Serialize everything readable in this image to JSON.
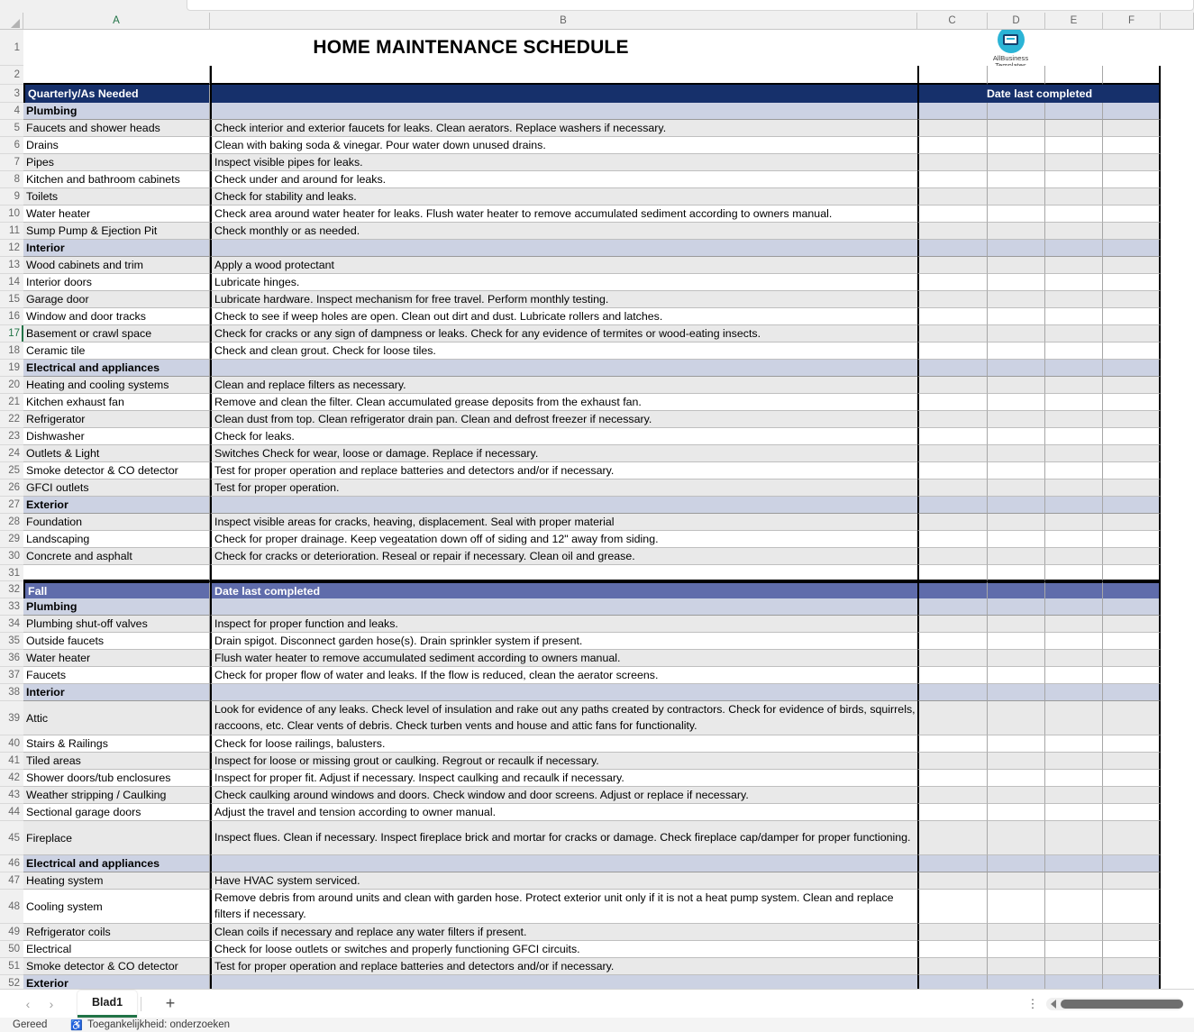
{
  "app": {
    "column_headers": [
      "A",
      "B",
      "C",
      "D",
      "E",
      "F"
    ],
    "selected_column": "A",
    "active_row": 17
  },
  "logo": {
    "icon": "monitor-icon",
    "line1": "AllBusiness",
    "line2": "Templates"
  },
  "title": "HOME MAINTENANCE SCHEDULE",
  "headers": {
    "quarterly": "Quarterly/As Needed",
    "date_last_completed": "Date last completed",
    "fall": "Fall",
    "fall_date": "Date last completed"
  },
  "rows": [
    {
      "n": 1,
      "type": "title",
      "a": "",
      "b": ""
    },
    {
      "n": 2,
      "type": "blank",
      "a": "",
      "b": ""
    },
    {
      "n": 3,
      "type": "navy",
      "a": "Quarterly/As Needed",
      "b": ""
    },
    {
      "n": 4,
      "type": "section",
      "a": "Plumbing",
      "b": ""
    },
    {
      "n": 5,
      "type": "shaded",
      "a": "Faucets and shower heads",
      "b": "Check interior and exterior faucets for leaks. Clean aerators. Replace washers if necessary."
    },
    {
      "n": 6,
      "type": "white",
      "a": "Drains",
      "b": "Clean with baking soda & vinegar. Pour water down unused drains."
    },
    {
      "n": 7,
      "type": "shaded",
      "a": "Pipes",
      "b": "Inspect visible pipes for leaks."
    },
    {
      "n": 8,
      "type": "white",
      "a": "Kitchen and bathroom cabinets",
      "b": "Check under and around for leaks."
    },
    {
      "n": 9,
      "type": "shaded",
      "a": "Toilets",
      "b": "Check for stability and leaks."
    },
    {
      "n": 10,
      "type": "white",
      "a": "Water heater",
      "b": "Check area around water heater for leaks. Flush water heater to remove accumulated sediment according to owners manual."
    },
    {
      "n": 11,
      "type": "shaded",
      "a": "Sump Pump & Ejection Pit",
      "b": "Check monthly or as needed."
    },
    {
      "n": 12,
      "type": "section",
      "a": "Interior",
      "b": ""
    },
    {
      "n": 13,
      "type": "shaded",
      "a": "Wood cabinets and trim",
      "b": "Apply a wood protectant"
    },
    {
      "n": 14,
      "type": "white",
      "a": "Interior doors",
      "b": "Lubricate hinges."
    },
    {
      "n": 15,
      "type": "shaded",
      "a": "Garage door",
      "b": "Lubricate hardware. Inspect mechanism for free travel.  Perform monthly testing."
    },
    {
      "n": 16,
      "type": "white",
      "a": "Window and door tracks",
      "b": "Check to see if weep holes are open. Clean out dirt and dust. Lubricate rollers and latches."
    },
    {
      "n": 17,
      "type": "shaded",
      "a": "Basement or crawl space",
      "b": "Check for cracks or any sign of dampness or leaks. Check for any evidence of termites or wood-eating insects."
    },
    {
      "n": 18,
      "type": "white",
      "a": "Ceramic tile",
      "b": "Check and clean grout. Check for loose tiles."
    },
    {
      "n": 19,
      "type": "section",
      "a": "Electrical and appliances",
      "b": ""
    },
    {
      "n": 20,
      "type": "shaded",
      "a": "Heating and cooling systems",
      "b": "Clean and replace filters as necessary."
    },
    {
      "n": 21,
      "type": "white",
      "a": "Kitchen exhaust fan",
      "b": "Remove and clean the filter. Clean accumulated grease deposits from the exhaust fan."
    },
    {
      "n": 22,
      "type": "shaded",
      "a": "Refrigerator",
      "b": "Clean dust from top. Clean refrigerator drain pan. Clean and defrost freezer if necessary."
    },
    {
      "n": 23,
      "type": "white",
      "a": "Dishwasher",
      "b": "Check for leaks."
    },
    {
      "n": 24,
      "type": "shaded",
      "a": "Outlets & Light",
      "b": "Switches Check for wear, loose or damage. Replace if necessary."
    },
    {
      "n": 25,
      "type": "white",
      "a": "Smoke detector & CO detector",
      "b": "Test for proper operation and replace batteries and detectors and/or if necessary."
    },
    {
      "n": 26,
      "type": "shaded",
      "a": "GFCI outlets",
      "b": "Test for proper operation."
    },
    {
      "n": 27,
      "type": "section",
      "a": "Exterior",
      "b": ""
    },
    {
      "n": 28,
      "type": "shaded",
      "a": "Foundation",
      "b": "Inspect visible areas for cracks, heaving, displacement.  Seal with proper material"
    },
    {
      "n": 29,
      "type": "white",
      "a": "Landscaping",
      "b": "Check for proper drainage. Keep vegeatation down off of siding and 12\" away from siding."
    },
    {
      "n": 30,
      "type": "shaded",
      "a": "Concrete and asphalt",
      "b": "Check for cracks or deterioration. Reseal or repair if necessary. Clean oil and grease."
    },
    {
      "n": 31,
      "type": "empty",
      "a": "",
      "b": ""
    },
    {
      "n": 32,
      "type": "purple",
      "a": "Fall",
      "b": "Date last completed"
    },
    {
      "n": 33,
      "type": "section",
      "a": "Plumbing",
      "b": ""
    },
    {
      "n": 34,
      "type": "shaded",
      "a": "Plumbing shut-off valves",
      "b": "Inspect for proper function and leaks."
    },
    {
      "n": 35,
      "type": "white",
      "a": "Outside faucets",
      "b": "Drain spigot.  Disconnect garden hose(s).  Drain sprinkler system if present."
    },
    {
      "n": 36,
      "type": "shaded",
      "a": "Water heater",
      "b": "Flush water heater to remove accumulated sediment according to owners manual."
    },
    {
      "n": 37,
      "type": "white",
      "a": "Faucets",
      "b": "Check for proper flow of water and leaks. If the flow is reduced, clean the aerator screens."
    },
    {
      "n": 38,
      "type": "section",
      "a": "Interior",
      "b": ""
    },
    {
      "n": 39,
      "type": "shadedtall",
      "a": "Attic",
      "b": "Look for evidence of any leaks. Check level of insulation and rake out any paths created by contractors.  Check for evidence of birds, squirrels, raccoons, etc. Clear vents of debris.  Check turben vents and house and attic fans for functionality."
    },
    {
      "n": 40,
      "type": "white",
      "a": "Stairs & Railings",
      "b": "Check for loose railings, balusters."
    },
    {
      "n": 41,
      "type": "shaded",
      "a": "Tiled areas",
      "b": "Inspect for loose or missing grout or caulking. Regrout or recaulk if necessary."
    },
    {
      "n": 42,
      "type": "white",
      "a": "Shower doors/tub enclosures",
      "b": "Inspect for proper fit. Adjust if necessary. Inspect caulking and recaulk if necessary."
    },
    {
      "n": 43,
      "type": "shaded",
      "a": "Weather stripping / Caulking",
      "b": "Check caulking around windows and doors. Check window and door screens. Adjust or replace if necessary."
    },
    {
      "n": 44,
      "type": "white",
      "a": "Sectional garage doors",
      "b": "Adjust the travel and tension according to owner manual."
    },
    {
      "n": 45,
      "type": "shadedtall",
      "a": "Fireplace",
      "b": "Inspect flues. Clean if necessary. Inspect fireplace brick and mortar for cracks or damage.  Check fireplace cap/damper for proper functioning."
    },
    {
      "n": 46,
      "type": "section",
      "a": "Electrical and appliances",
      "b": ""
    },
    {
      "n": 47,
      "type": "shaded",
      "a": "Heating system",
      "b": "Have HVAC system serviced."
    },
    {
      "n": 48,
      "type": "whitetall",
      "a": "Cooling system",
      "b": "Remove debris from around units and clean with garden hose.  Protect exterior unit only if it is not a heat pump system.  Clean and replace filters if necessary."
    },
    {
      "n": 49,
      "type": "shaded",
      "a": "Refrigerator coils",
      "b": "Clean coils if necessary and replace any water filters if present."
    },
    {
      "n": 50,
      "type": "white",
      "a": "Electrical",
      "b": "Check for loose outlets or switches and properly functioning GFCI circuits."
    },
    {
      "n": 51,
      "type": "shaded",
      "a": "Smoke detector & CO detector",
      "b": "Test for proper operation and replace batteries and detectors and/or if necessary."
    },
    {
      "n": 52,
      "type": "section",
      "a": "Exterior",
      "b": ""
    }
  ],
  "tabbar": {
    "prev": "‹",
    "next": "›",
    "sheet_name": "Blad1",
    "add_sheet": "+",
    "kebab": "⋮"
  },
  "statusbar": {
    "ready": "Gereed",
    "accessibility": "Toegankelijkheid: onderzoeken",
    "accessibility_icon": "accessibility-icon"
  },
  "colors": {
    "navy": "#16306b",
    "purple": "#5f6cab",
    "section": "#ccd2e3",
    "shaded": "#e9e9e9",
    "accent_green": "#217346",
    "logo_teal": "#2bb4d6"
  }
}
